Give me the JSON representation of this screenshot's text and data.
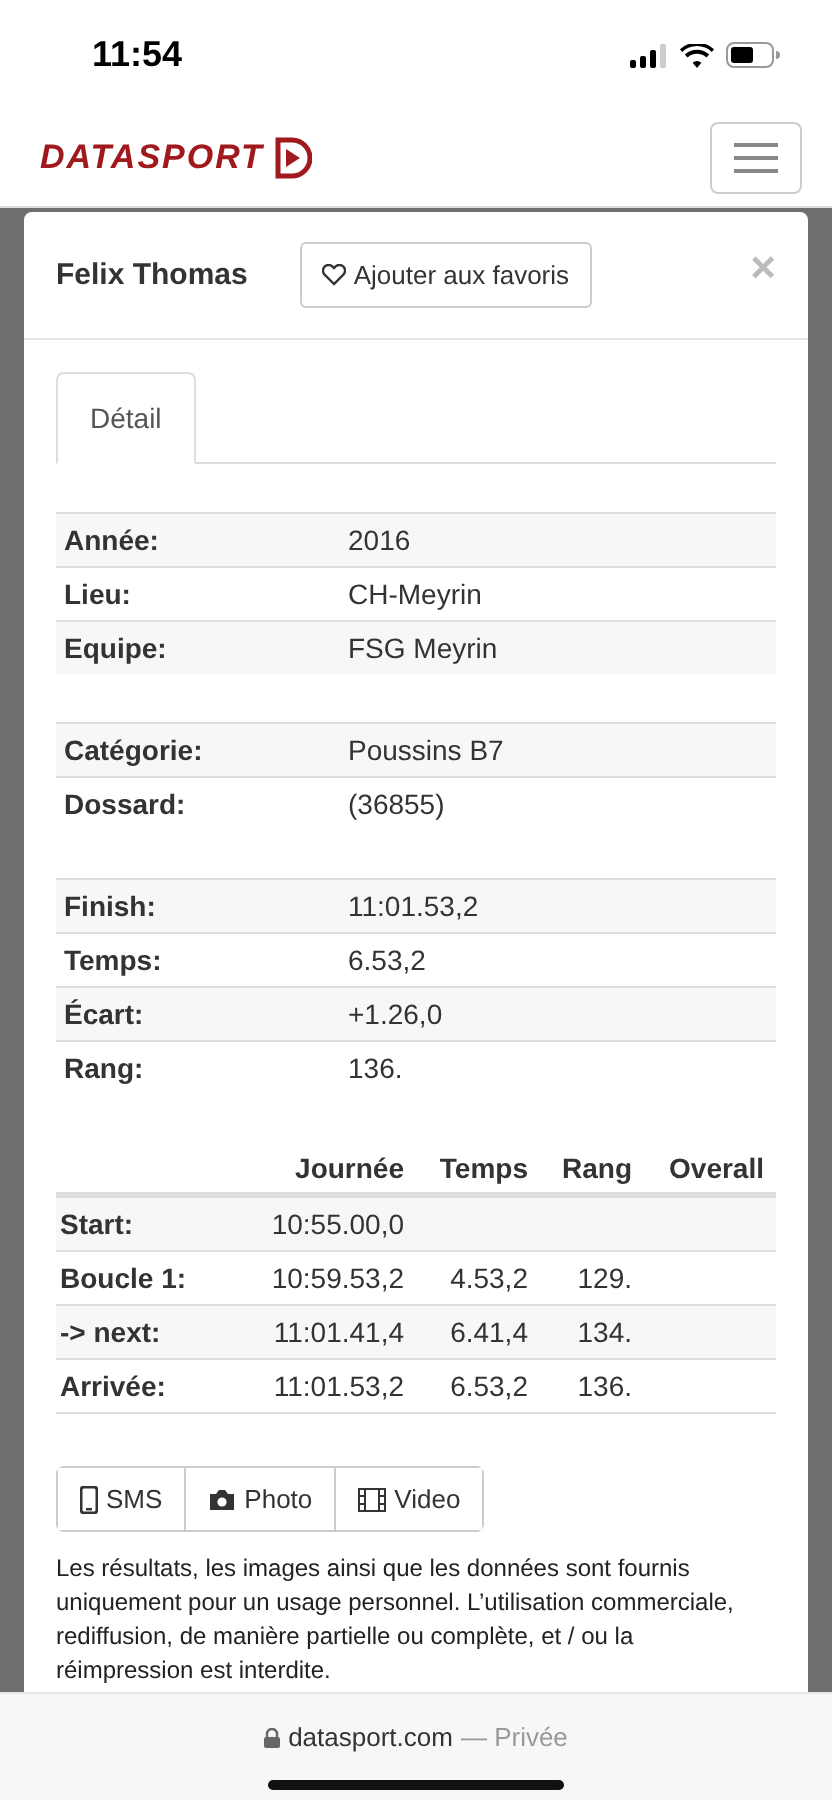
{
  "status_bar": {
    "time": "11:54"
  },
  "header": {
    "logo": "DATASPORT"
  },
  "modal": {
    "name": "Felix Thomas",
    "favorite_button": "Ajouter aux favoris",
    "close": "×",
    "tabs": [
      {
        "label": "Détail",
        "selected": true
      }
    ],
    "info_groups": [
      [
        {
          "label": "Année:",
          "value": "2016"
        },
        {
          "label": "Lieu:",
          "value": "CH-Meyrin"
        },
        {
          "label": "Equipe:",
          "value": "FSG Meyrin"
        }
      ],
      [
        {
          "label": "Catégorie:",
          "value": "Poussins B7"
        },
        {
          "label": "Dossard:",
          "value": "(36855)"
        }
      ],
      [
        {
          "label": "Finish:",
          "value": "11:01.53,2"
        },
        {
          "label": "Temps:",
          "value": "6.53,2"
        },
        {
          "label": "Écart:",
          "value": "+1.26,0"
        },
        {
          "label": "Rang:",
          "value": "136."
        }
      ]
    ],
    "splits": {
      "columns": [
        "Journée",
        "Temps",
        "Rang",
        "Overall"
      ],
      "rows": [
        {
          "label": "Start:",
          "cells": [
            "10:55.00,0"
          ]
        },
        {
          "label": "Boucle 1:",
          "cells": [
            "10:59.53,2",
            "4.53,2",
            "129."
          ]
        },
        {
          "label": "-> next:",
          "cells": [
            "11:01.41,4",
            "6.41,4",
            "134."
          ]
        },
        {
          "label": "Arrivée:",
          "cells": [
            "11:01.53,2",
            "6.53,2",
            "136."
          ]
        }
      ]
    },
    "actions": [
      {
        "kind": "phone",
        "label": "SMS"
      },
      {
        "kind": "camera",
        "label": "Photo"
      },
      {
        "kind": "film",
        "label": "Video"
      }
    ],
    "disclaimer": "Les résultats, les images ainsi que les données sont fournis uniquement pour un usage personnel. L’utilisation commerciale, rediffusion, de manière partielle ou complète, et / ou la réimpression est interdite."
  },
  "browser_bar": {
    "address": "datasport.com",
    "mode": "— Privée"
  }
}
